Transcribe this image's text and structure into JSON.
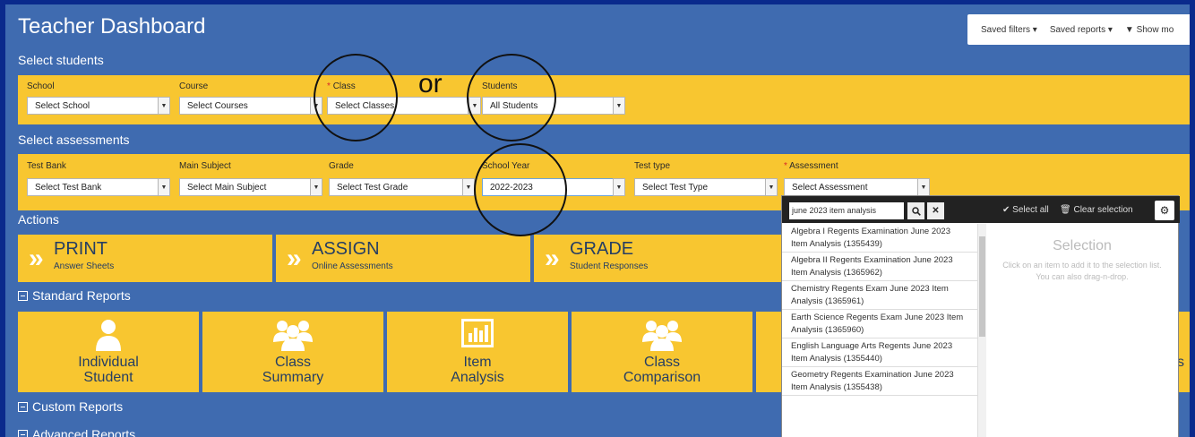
{
  "page_title": "Teacher Dashboard",
  "toolbar": {
    "saved_filters": "Saved filters ▾",
    "saved_reports": "Saved reports ▾",
    "show_more": "Show mo"
  },
  "select_students": {
    "heading": "Select students",
    "school_label": "School",
    "school_value": "Select School",
    "course_label": "Course",
    "course_value": "Select Courses",
    "class_required": "*",
    "class_label": "Class",
    "class_value": "Select Classes",
    "or_text": "or",
    "students_label": "Students",
    "students_value": "All Students"
  },
  "select_assessments": {
    "heading": "Select assessments",
    "test_bank_label": "Test Bank",
    "test_bank_value": "Select Test Bank",
    "main_subject_label": "Main Subject",
    "main_subject_value": "Select Main Subject",
    "grade_label": "Grade",
    "grade_value": "Select Test Grade",
    "school_year_label": "School Year",
    "school_year_value": "2022-2023",
    "test_type_label": "Test type",
    "test_type_value": "Select Test Type",
    "assessment_required": "*",
    "assessment_label": "Assessment",
    "assessment_value": "Select Assessment"
  },
  "actions": {
    "heading": "Actions",
    "print_title": "PRINT",
    "print_sub": "Answer Sheets",
    "assign_title": "ASSIGN",
    "assign_sub": "Online Assessments",
    "grade_title": "GRADE",
    "grade_sub": "Student Responses"
  },
  "standard_reports": {
    "heading": "Standard Reports",
    "individual_l1": "Individual",
    "individual_l2": "Student",
    "class_summary_l1": "Class",
    "class_summary_l2": "Summary",
    "item_analysis_l1": "Item",
    "item_analysis_l2": "Analysis",
    "class_comparison_l1": "Class",
    "class_comparison_l2": "Comparison",
    "partial_label": "s"
  },
  "custom_reports": {
    "heading": "Custom Reports"
  },
  "advanced_reports": {
    "heading": "Advanced Reports"
  },
  "dropdown": {
    "search_value": "june 2023 item analysis",
    "select_all": "✔ Select all",
    "clear_selection": "🗑 Clear selection",
    "selection_title": "Selection",
    "selection_hint": "Click on an item to add it to the selection list. You can also drag-n-drop.",
    "items": [
      "Algebra I Regents Examination June 2023 Item Analysis (1355439)",
      "Algebra II Regents Examination June 2023 Item Analysis (1365962)",
      "Chemistry Regents Exam June 2023 Item Analysis (1365961)",
      "Earth Science Regents Exam June 2023 Item Analysis (1365960)",
      "English Language Arts Regents June 2023 Item Analysis (1355440)",
      "Geometry Regents Examination June 2023 Item Analysis (1355438)"
    ]
  },
  "colors": {
    "page_bg": "#3f6bb0",
    "band": "#f8c630",
    "frame": "#0a2a8c",
    "text_dark": "#263e63"
  }
}
